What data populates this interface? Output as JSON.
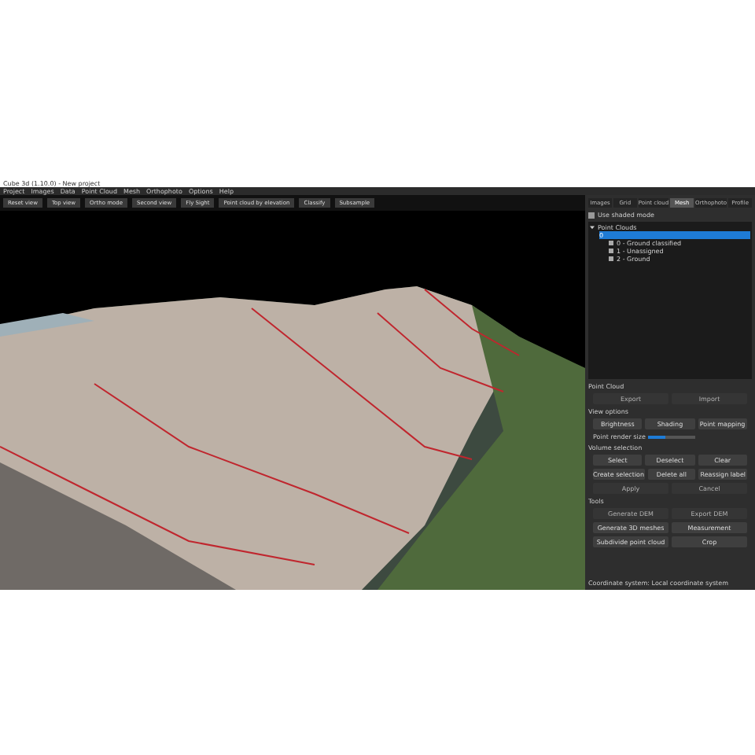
{
  "window": {
    "title": "Cube 3d (1.10.0) - New project"
  },
  "menu": [
    "Project",
    "Images",
    "Data",
    "Point Cloud",
    "Mesh",
    "Orthophoto",
    "Options",
    "Help"
  ],
  "toolbar": [
    "Reset view",
    "Top view",
    "Ortho mode",
    "Second view",
    "Fly Sight",
    "Point cloud by elevation",
    "Classify",
    "Subsample"
  ],
  "panel": {
    "tabs": [
      {
        "label": "Images",
        "selected": false
      },
      {
        "label": "Grid",
        "selected": false
      },
      {
        "label": "Point cloud",
        "selected": false
      },
      {
        "label": "Mesh",
        "selected": true
      },
      {
        "label": "Orthophoto",
        "selected": false
      },
      {
        "label": "Profile",
        "selected": false
      }
    ],
    "show_checkbox": {
      "label": "Use shaded mode",
      "checked": true
    },
    "tree": [
      {
        "label": "Point Clouds",
        "expanded": true,
        "children": [
          {
            "label": "0",
            "selected": true,
            "children": [
              {
                "label": "0 - Ground classified",
                "checked": true
              },
              {
                "label": "1 - Unassigned",
                "checked": true
              },
              {
                "label": "2 - Ground",
                "checked": true
              }
            ]
          }
        ]
      }
    ],
    "sections": [
      {
        "title": "Point Cloud",
        "rows": [
          [
            {
              "label": "Export",
              "disabled": true
            },
            {
              "label": "Import",
              "disabled": true
            }
          ]
        ]
      },
      {
        "title": "View options",
        "rows": [
          [
            {
              "label": "Brightness",
              "disabled": false
            },
            {
              "label": "Shading",
              "disabled": false
            },
            {
              "label": "Point mapping",
              "disabled": false
            }
          ]
        ],
        "slider": {
          "label": "Point render size",
          "level": 0.35
        }
      },
      {
        "title": "Volume selection",
        "rows": [
          [
            {
              "label": "Select",
              "disabled": false
            },
            {
              "label": "Deselect",
              "disabled": false
            },
            {
              "label": "Clear",
              "disabled": false
            }
          ],
          [
            {
              "label": "Create selection",
              "disabled": false
            },
            {
              "label": "Delete all",
              "disabled": false
            },
            {
              "label": "Reassign label",
              "disabled": false
            }
          ],
          [
            {
              "label": "Apply",
              "disabled": true
            },
            {
              "label": "Cancel",
              "disabled": true
            }
          ]
        ]
      },
      {
        "title": "Tools",
        "rows": [
          [
            {
              "label": "Generate DEM",
              "disabled": true
            },
            {
              "label": "Export DEM",
              "disabled": true
            }
          ],
          [
            {
              "label": "Generate 3D meshes",
              "disabled": false
            },
            {
              "label": "Measurement",
              "disabled": false
            }
          ],
          [
            {
              "label": "Subdivide point cloud",
              "disabled": false
            },
            {
              "label": "Crop",
              "disabled": false
            }
          ]
        ]
      }
    ]
  },
  "status_bar": "Coordinate system: Local coordinate system"
}
